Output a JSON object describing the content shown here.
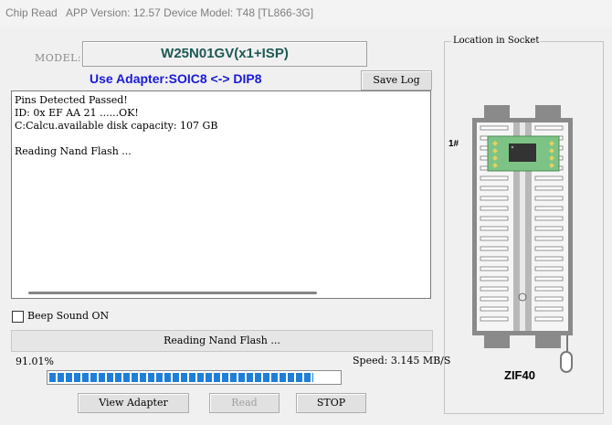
{
  "titlebar": {
    "app_name": "Chip Read",
    "version_text": "APP Version: 12.57 Device Model: T48 [TL866-3G]"
  },
  "model": {
    "label": "MODEL:",
    "value": "W25N01GV(x1+ISP)"
  },
  "adapter_text": "Use Adapter:SOIC8 <-> DIP8",
  "buttons": {
    "save_log": "Save Log",
    "view_adapter": "View Adapter",
    "read": "Read",
    "stop": "STOP"
  },
  "log_lines": [
    "Pins Detected Passed!",
    "ID: 0x EF AA 21 ......OK!",
    "C:Calcu.available disk capacity: 107 GB",
    "",
    "Reading Nand Flash ..."
  ],
  "beep_sound": {
    "label": "Beep Sound ON",
    "checked": false
  },
  "status": {
    "message": "Reading Nand Flash ...",
    "percent_text": "91.01%",
    "progress": 0.9101,
    "speed_text": "Speed: 3.145 MB/S"
  },
  "socket": {
    "group_title": "Location in Socket",
    "pin1_label": "1#",
    "zif_label": "ZIF40",
    "pin_rows_per_side": 20
  },
  "colors": {
    "model_text": "#1d5a55",
    "adapter_text": "#1a1ad8",
    "progress_fill": "#1f7fd8",
    "socket_body": "#8a8a8a",
    "adapter_board": "#7ec386"
  }
}
